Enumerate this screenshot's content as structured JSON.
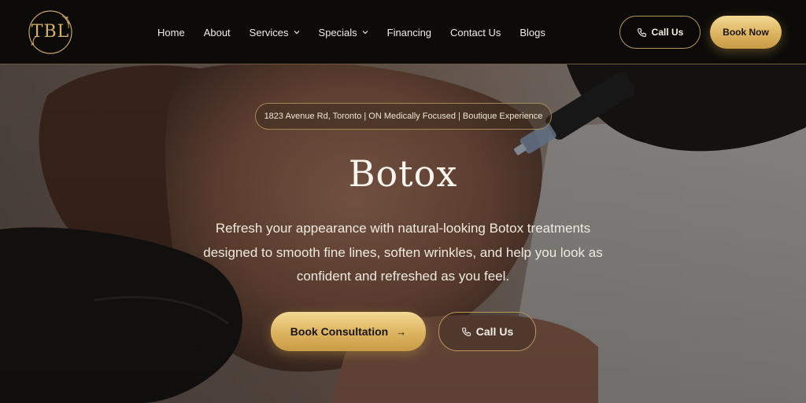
{
  "header": {
    "logo_text": "TBL",
    "nav": [
      {
        "label": "Home",
        "dropdown": false
      },
      {
        "label": "About",
        "dropdown": false
      },
      {
        "label": "Services",
        "dropdown": true
      },
      {
        "label": "Specials",
        "dropdown": true
      },
      {
        "label": "Financing",
        "dropdown": false
      },
      {
        "label": "Contact Us",
        "dropdown": false
      },
      {
        "label": "Blogs",
        "dropdown": false
      }
    ],
    "call_label": "Call Us",
    "book_label": "Book Now"
  },
  "hero": {
    "location": "1823 Avenue Rd, Toronto | ON Medically Focused | Boutique Experience",
    "title": "Botox",
    "subtitle": "Refresh your appearance with natural-looking Botox treatments designed to smooth fine lines, soften wrinkles, and help you look as confident and refreshed as you feel.",
    "primary_cta": "Book Consultation",
    "secondary_cta": "Call Us"
  },
  "colors": {
    "header_bg": "#0c0b09",
    "gold": "#dcb35f",
    "gold_border": "#b8955a",
    "text_light": "#f0ede6"
  },
  "icons": [
    "phone-icon",
    "chevron-down-icon",
    "arrow-right-icon"
  ]
}
